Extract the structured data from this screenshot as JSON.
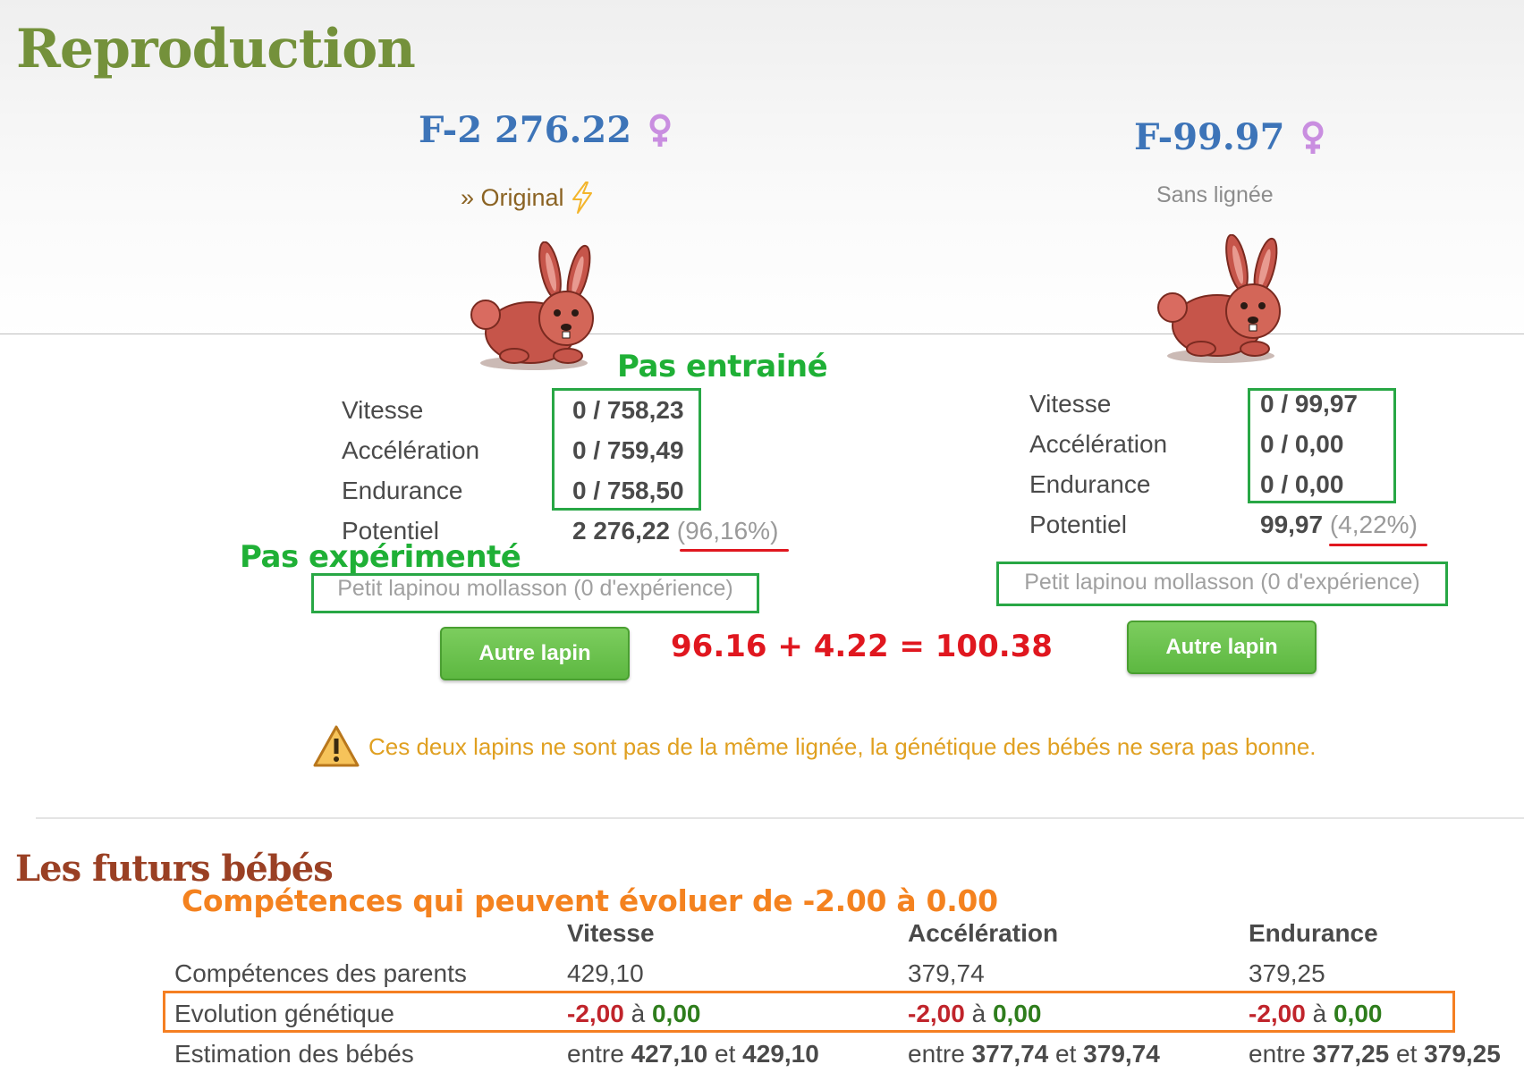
{
  "page_title": "Reproduction",
  "left": {
    "name": "F-2 276.22",
    "lineage_prefix": "» Original",
    "stats": [
      {
        "label": "Vitesse",
        "value": "0 / 758,23"
      },
      {
        "label": "Accélération",
        "value": "0 / 759,49"
      },
      {
        "label": "Endurance",
        "value": "0 / 758,50"
      }
    ],
    "potential_label": "Potentiel",
    "potential_value": "2 276,22",
    "potential_pct": "(96,16%)",
    "experience": "Petit lapinou mollasson (0 d'expérience)",
    "button": "Autre lapin"
  },
  "right": {
    "name": "F-99.97",
    "lineage": "Sans lignée",
    "stats": [
      {
        "label": "Vitesse",
        "value": "0 / 99,97"
      },
      {
        "label": "Accélération",
        "value": "0 / 0,00"
      },
      {
        "label": "Endurance",
        "value": "0 / 0,00"
      }
    ],
    "potential_label": "Potentiel",
    "potential_value": "99,97",
    "potential_pct": "(4,22%)",
    "experience": "Petit lapinou mollasson (0 d'expérience)",
    "button": "Autre lapin"
  },
  "annotations": {
    "not_trained": "Pas entrainé",
    "not_experienced": "Pas expérimenté",
    "sum": "96.16 + 4.22 = 100.38",
    "skills_note": "Compétences qui peuvent évoluer de -2.00 à 0.00"
  },
  "warning": "Ces deux lapins ne sont pas de la même lignée, la génétique des bébés ne sera pas bonne.",
  "futures": {
    "title": "Les futurs bébés",
    "columns": [
      "Vitesse",
      "Accélération",
      "Endurance"
    ],
    "parents_label": "Compétences des parents",
    "parents": [
      "429,10",
      "379,74",
      "379,25"
    ],
    "evolution_label": "Evolution génétique",
    "evolution": [
      {
        "min": "-2,00",
        "to": "à",
        "max": "0,00"
      },
      {
        "min": "-2,00",
        "to": "à",
        "max": "0,00"
      },
      {
        "min": "-2,00",
        "to": "à",
        "max": "0,00"
      }
    ],
    "estimate_label": "Estimation des bébés",
    "estimates": [
      {
        "between": "entre",
        "low": "427,10",
        "and": "et",
        "high": "429,10"
      },
      {
        "between": "entre",
        "low": "377,74",
        "and": "et",
        "high": "379,74"
      },
      {
        "between": "entre",
        "low": "377,25",
        "and": "et",
        "high": "379,25"
      }
    ]
  },
  "colors": {
    "title_green": "#74913b",
    "name_blue": "#3d74b8",
    "annotation_green": "#1fb036",
    "annotation_red": "#e0171f",
    "annotation_orange": "#f4821f",
    "warning_text": "#e0a021",
    "button_green": "#5db841",
    "section_title": "#9a4024"
  },
  "icons": [
    "female-icon",
    "lightning-icon",
    "rabbit-image",
    "warning-icon"
  ]
}
